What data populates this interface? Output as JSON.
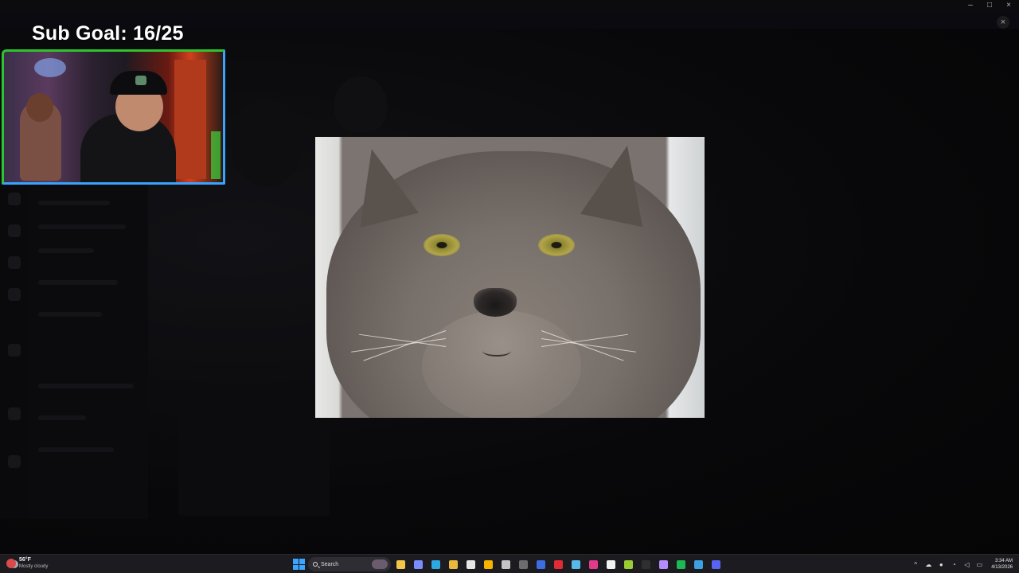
{
  "overlay": {
    "sub_goal": "Sub Goal: 16/25"
  },
  "window": {
    "minimize_glyph": "–",
    "maximize_glyph": "□",
    "close_glyph": "×",
    "overlay_close_glyph": "×"
  },
  "taskbar": {
    "weather_temp": "56°F",
    "weather_condition": "Mostly cloudy",
    "search_label": "Search",
    "pinned_apps": [
      {
        "name": "file-explorer-icon",
        "color": "#f3c64a"
      },
      {
        "name": "copilot-icon",
        "color": "#7b8cff"
      },
      {
        "name": "edge-icon",
        "color": "#2ea8e0"
      },
      {
        "name": "folder-icon",
        "color": "#e8b93c"
      },
      {
        "name": "store-icon",
        "color": "#e6e6e6"
      },
      {
        "name": "chrome-icon",
        "color": "#f4b400"
      },
      {
        "name": "app-icon",
        "color": "#c4c4c4"
      },
      {
        "name": "obs-icon",
        "color": "#6d6d6d"
      },
      {
        "name": "vpn-icon",
        "color": "#3d6de0"
      },
      {
        "name": "opera-icon",
        "color": "#e02b37"
      },
      {
        "name": "notepad-icon",
        "color": "#58b8e8"
      },
      {
        "name": "maps-icon",
        "color": "#e23a8a"
      },
      {
        "name": "capcut-icon",
        "color": "#f2f2f2"
      },
      {
        "name": "xbox-icon",
        "color": "#9acd32"
      },
      {
        "name": "terminal-icon",
        "color": "#2f2f2f"
      },
      {
        "name": "streamlabs-icon",
        "color": "#b48cff"
      },
      {
        "name": "spotify-icon",
        "color": "#1db954"
      },
      {
        "name": "files-icon",
        "color": "#3da0e0"
      },
      {
        "name": "discord-icon",
        "color": "#5865f2"
      }
    ],
    "tray": {
      "chevron_glyph": "^",
      "clock_time": "3:34 AM",
      "clock_date": "4/13/2026"
    }
  }
}
